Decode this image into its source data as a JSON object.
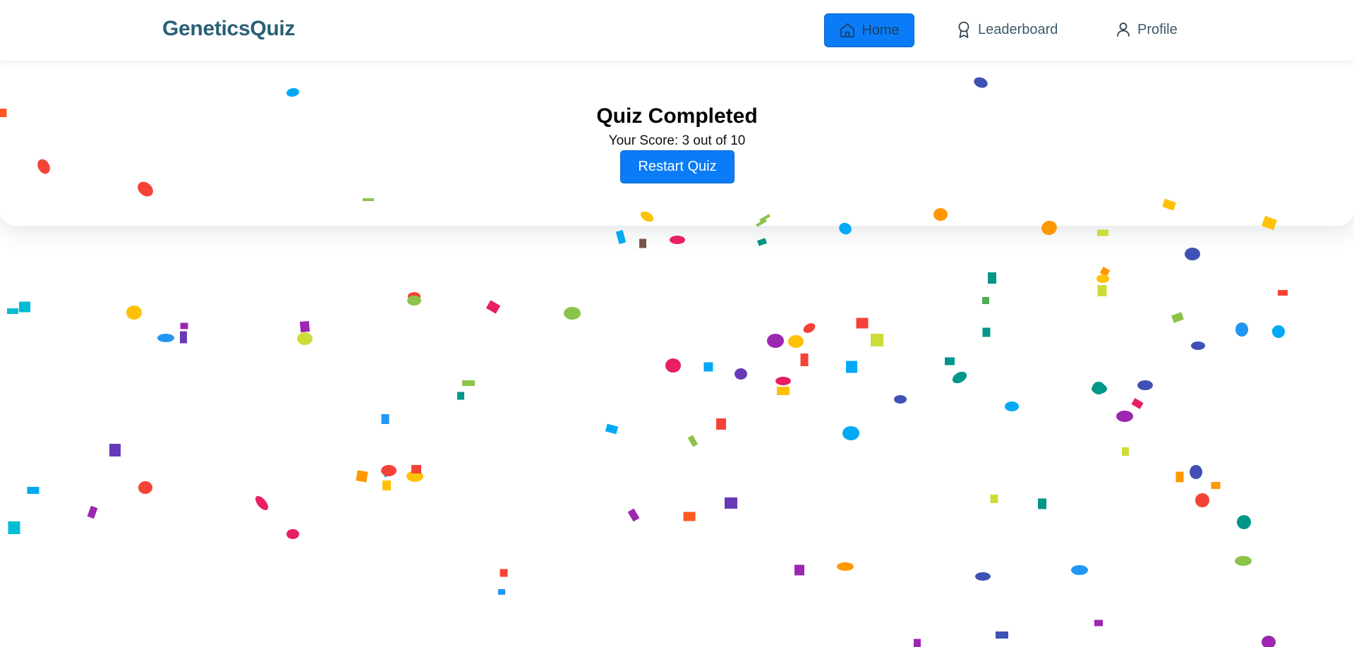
{
  "app": {
    "brand": "GeneticsQuiz"
  },
  "nav": {
    "items": [
      {
        "label": "Home",
        "icon": "home-icon",
        "active": true
      },
      {
        "label": "Leaderboard",
        "icon": "award-ribbon-icon",
        "active": false
      },
      {
        "label": "Profile",
        "icon": "user-icon",
        "active": false
      }
    ]
  },
  "result": {
    "title": "Quiz Completed",
    "score_text": "Your Score: 3 out of 10",
    "restart_label": "Restart Quiz"
  },
  "colors": {
    "brand_text": "#2a5f77",
    "accent": "#0a7cf8",
    "confetti": [
      "#f44336",
      "#e91e63",
      "#9c27b0",
      "#673ab7",
      "#3f51b5",
      "#2196f3",
      "#03a9f4",
      "#00bcd4",
      "#009688",
      "#4caf50",
      "#8bc34a",
      "#cddc39",
      "#ffeb3b",
      "#ffc107",
      "#ff9800",
      "#ff5722",
      "#795548"
    ]
  },
  "decoration": {
    "confetti_effect": true
  }
}
